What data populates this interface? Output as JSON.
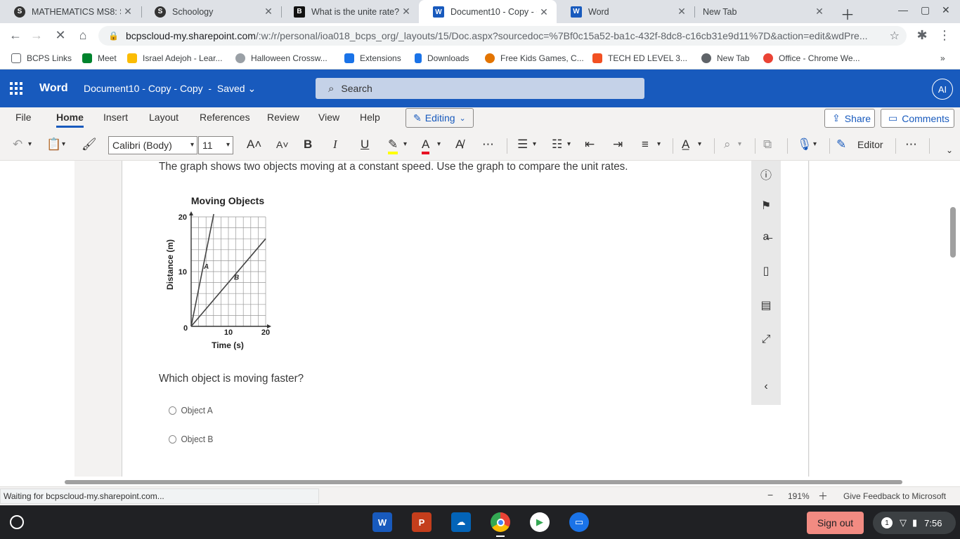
{
  "tabs": [
    {
      "title": "MATHEMATICS MS8: Se",
      "favicon": "S"
    },
    {
      "title": "Schoology",
      "favicon": "S"
    },
    {
      "title": "What is the unite rate? - ",
      "favicon": "B"
    },
    {
      "title": "Document10 - Copy - Co",
      "favicon": "W"
    },
    {
      "title": "Word",
      "favicon": "W"
    },
    {
      "title": "New Tab",
      "favicon": ""
    }
  ],
  "address": {
    "host": "bcpscloud-my.sharepoint.com",
    "path": "/:w:/r/personal/ioa018_bcps_org/_layouts/15/Doc.aspx?sourcedoc=%7Bf0c15a52-ba1c-432f-8dc8-c16cb31e9d11%7D&action=edit&wdPre..."
  },
  "bookmarks": [
    {
      "label": "BCPS Links",
      "color": "#5f6368"
    },
    {
      "label": "Meet",
      "color": "#00832d"
    },
    {
      "label": "Israel Adejoh - Lear...",
      "color": "#fbbc04"
    },
    {
      "label": "Halloween Crossw...",
      "color": "#9aa0a6"
    },
    {
      "label": "Extensions",
      "color": "#1a73e8"
    },
    {
      "label": "Downloads",
      "color": "#1a73e8"
    },
    {
      "label": "Free Kids Games, C...",
      "color": "#e37400"
    },
    {
      "label": "TECH ED LEVEL 3...",
      "color": "#f25022"
    },
    {
      "label": "New Tab",
      "color": "#5f6368"
    },
    {
      "label": "Office - Chrome We...",
      "color": "#ea4335"
    }
  ],
  "word": {
    "app_name": "Word",
    "doc_title": "Document10 - Copy - Copy",
    "saved": "Saved",
    "search_placeholder": "Search",
    "avatar": "AI"
  },
  "menu": [
    "File",
    "Home",
    "Insert",
    "Layout",
    "References",
    "Review",
    "View",
    "Help"
  ],
  "editing_label": "Editing",
  "share_label": "Share",
  "comments_label": "Comments",
  "toolbar": {
    "font": "Calibri (Body)",
    "size": "11",
    "editor_label": "Editor"
  },
  "document": {
    "question": "The graph shows two objects moving at a constant speed. Use the graph to compare the unit rates.",
    "prompt": "Which object is moving faster?",
    "options": [
      "Object A",
      "Object B"
    ]
  },
  "chart_data": {
    "type": "line",
    "title": "Moving Objects",
    "xlabel": "Time (s)",
    "ylabel": "Distance (m)",
    "xlim": [
      0,
      20
    ],
    "ylim": [
      0,
      20
    ],
    "xticks": [
      0,
      10,
      20
    ],
    "yticks": [
      10,
      20
    ],
    "grid": true,
    "series": [
      {
        "name": "A",
        "x": [
          0,
          6.5
        ],
        "y": [
          0,
          22
        ]
      },
      {
        "name": "B",
        "x": [
          0,
          20
        ],
        "y": [
          0,
          16
        ]
      }
    ]
  },
  "status": {
    "loading": "Waiting for bcpscloud-my.sharepoint.com...",
    "zoom": "191%",
    "feedback": "Give Feedback to Microsoft"
  },
  "taskbar": {
    "signout": "Sign out",
    "time": "7:56",
    "notifications": "1"
  }
}
